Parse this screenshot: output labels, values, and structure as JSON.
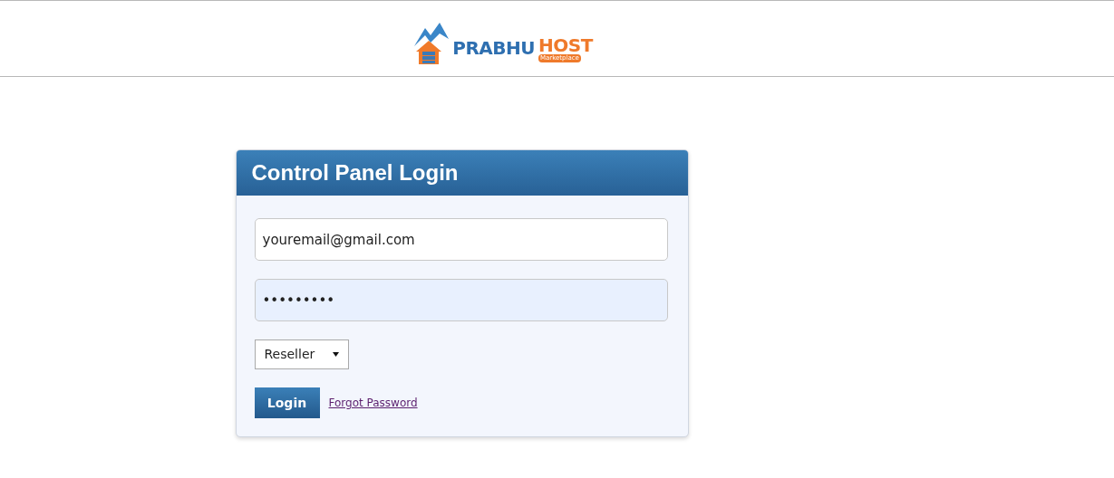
{
  "logo": {
    "word_1": "PRABHU",
    "word_2": "HOST",
    "tagline": "Marketplace"
  },
  "login_panel": {
    "title": "Control Panel Login",
    "email": {
      "value": "youremail@gmail.com"
    },
    "password": {
      "value": "•••••••••"
    },
    "account_type": {
      "value": "Reseller"
    },
    "login_button": "Login",
    "forgot_link": "Forgot Password"
  }
}
